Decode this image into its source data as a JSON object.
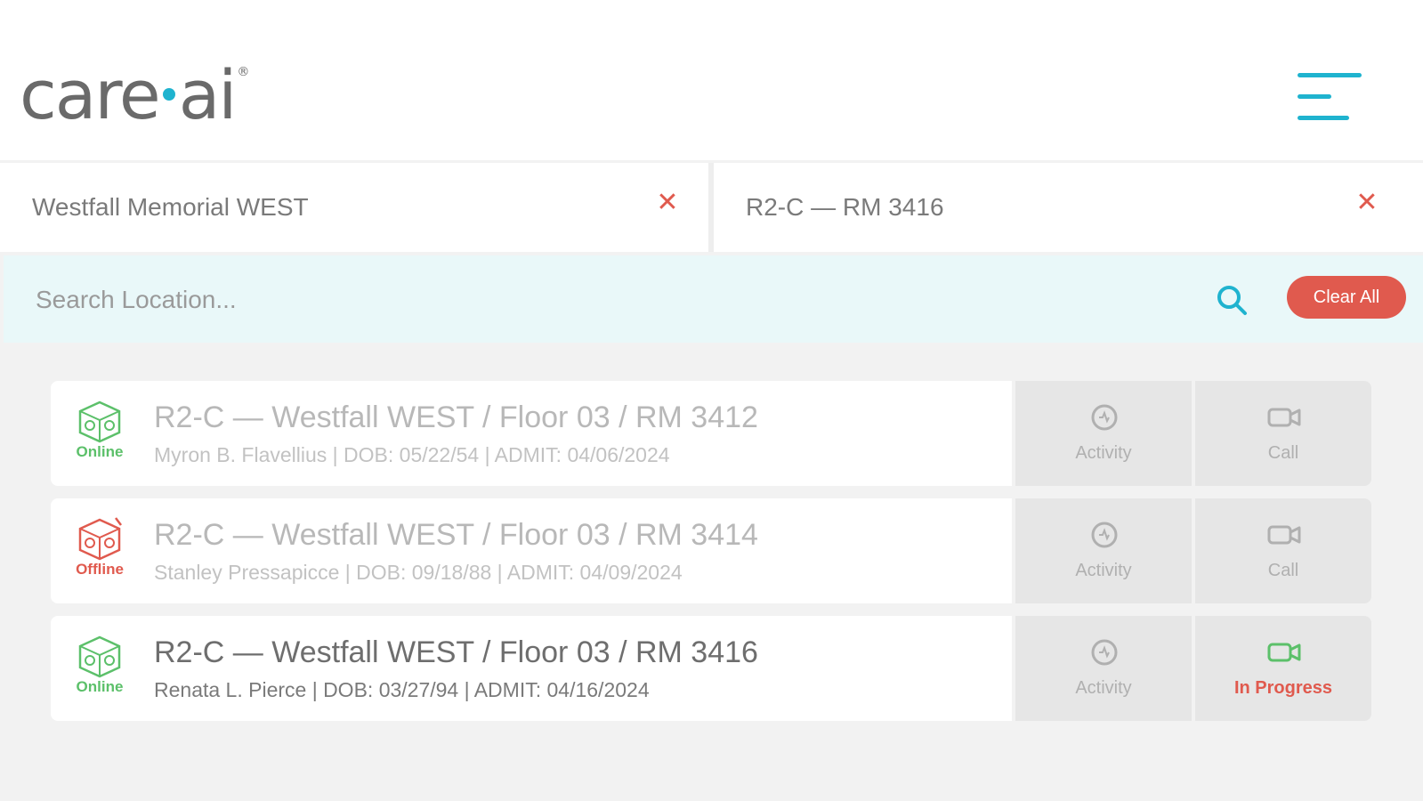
{
  "brand": {
    "logo_left": "care",
    "logo_right": "ai",
    "logo_mark": "®"
  },
  "filters": [
    {
      "label": "Westfall Memorial WEST",
      "remove_icon": "close-icon"
    },
    {
      "label": "R2-C — RM 3416",
      "remove_icon": "close-icon"
    }
  ],
  "search": {
    "placeholder": "Search Location...",
    "value": "",
    "clear_label": "Clear All"
  },
  "colors": {
    "accent": "#1fb3cf",
    "danger": "#e05a4e",
    "online": "#5cc06a",
    "offline": "#e05a4e"
  },
  "rooms": [
    {
      "status": "Online",
      "title": "R2-C — Westfall WEST / Floor 03 / RM 3412",
      "info": "Myron B. Flavellius  |  DOB:  05/22/54  |  ADMIT:  04/06/2024",
      "activity_label": "Activity",
      "call_label": "Call"
    },
    {
      "status": "Offline",
      "title": "R2-C — Westfall WEST / Floor 03 / RM 3414",
      "info": "Stanley Pressapicce  |  DOB:  09/18/88  |  ADMIT:  04/09/2024",
      "activity_label": "Activity",
      "call_label": "Call"
    },
    {
      "status": "Online",
      "title": "R2-C — Westfall WEST / Floor 03 / RM 3416",
      "info": "Renata L. Pierce  |  DOB:  03/27/94  |  ADMIT:  04/16/2024",
      "activity_label": "Activity",
      "call_label": "In Progress"
    }
  ]
}
